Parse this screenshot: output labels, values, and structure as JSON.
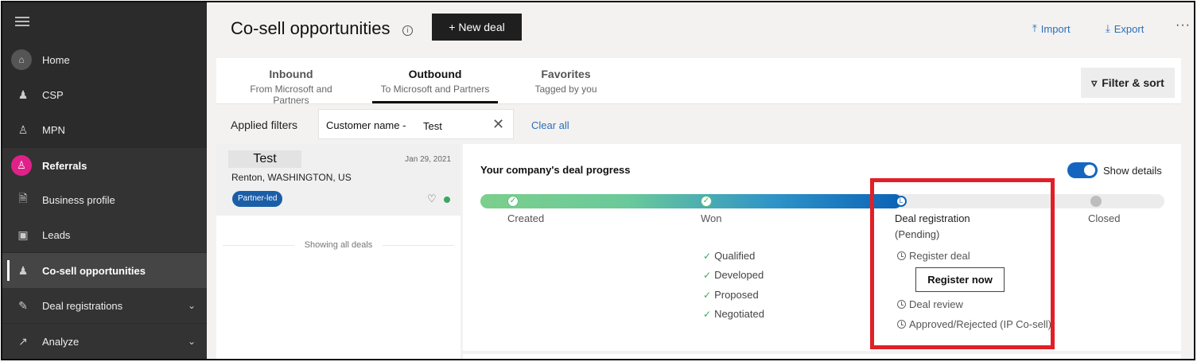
{
  "sidebar": {
    "items": [
      {
        "label": "Home"
      },
      {
        "label": "CSP"
      },
      {
        "label": "MPN"
      },
      {
        "label": "Referrals"
      },
      {
        "label": "Business profile"
      },
      {
        "label": "Leads"
      },
      {
        "label": "Co-sell opportunities"
      },
      {
        "label": "Deal registrations"
      },
      {
        "label": "Analyze"
      }
    ]
  },
  "header": {
    "title": "Co-sell opportunities",
    "new_deal_label": "+ New deal",
    "import_label": "Import",
    "export_label": "Export",
    "more_label": "···"
  },
  "tabs": [
    {
      "label": "Inbound",
      "sublabel": "From Microsoft and Partners"
    },
    {
      "label": "Outbound",
      "sublabel": "To Microsoft and Partners"
    },
    {
      "label": "Favorites",
      "sublabel": "Tagged by you"
    }
  ],
  "filter_sort_label": "Filter & sort",
  "filters": {
    "applied_label": "Applied filters",
    "chip_key": "Customer name -",
    "chip_value": "Test",
    "clear_all_label": "Clear all"
  },
  "deal": {
    "name": "Test",
    "date": "Jan 29, 2021",
    "location": "Renton, WASHINGTON, US",
    "badge": "Partner-led",
    "status_color": "#3aa760"
  },
  "list_footer": "Showing all deals",
  "progress": {
    "title": "Your company's deal progress",
    "toggle_label": "Show details",
    "toggle_on": true,
    "stages": [
      {
        "label": "Created",
        "state": "done"
      },
      {
        "label": "Won",
        "state": "done"
      },
      {
        "label": "Deal registration",
        "state": "pending",
        "sublabel": "(Pending)"
      },
      {
        "label": "Closed",
        "state": "future"
      }
    ],
    "won_steps": [
      "Qualified",
      "Developed",
      "Proposed",
      "Negotiated"
    ],
    "registration_steps": [
      "Register deal",
      "Deal review",
      "Approved/Rejected (IP Co-sell)"
    ],
    "register_button_label": "Register now"
  },
  "colors": {
    "accent": "#1565c0",
    "link": "#2a6fb8",
    "highlight": "#e11f26",
    "referrals_avatar": "#e0218a"
  }
}
